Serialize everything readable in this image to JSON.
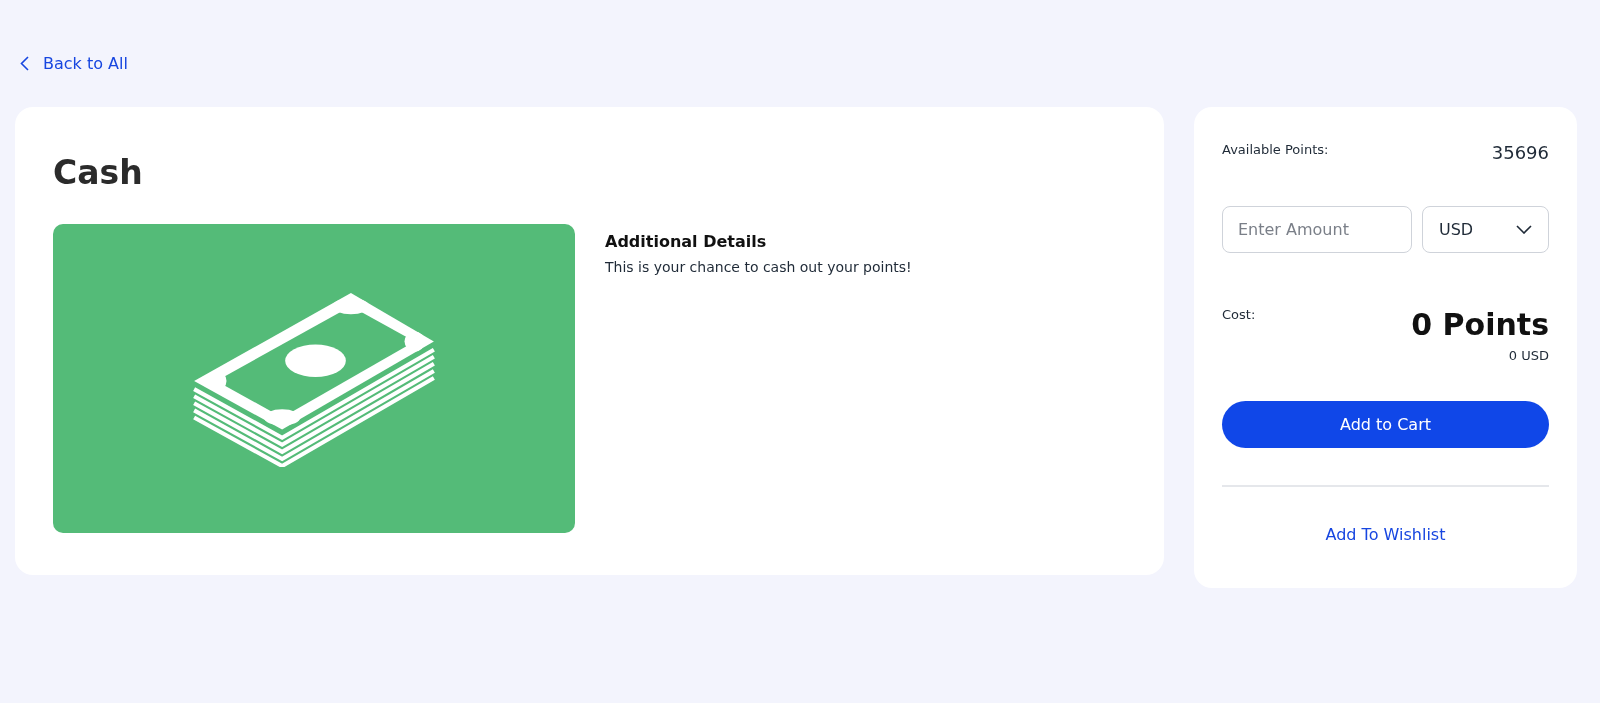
{
  "back_link": {
    "label": "Back to All"
  },
  "product": {
    "title": "Cash",
    "details_heading": "Additional Details",
    "details_text": "This is your chance to cash out your points!"
  },
  "purchase": {
    "available_label": "Available Points:",
    "available_value": "35696",
    "amount_field": {
      "placeholder": "Enter Amount"
    },
    "currency": "USD",
    "cost_label": "Cost:",
    "cost_points": "0 Points",
    "cost_currency": "0 USD",
    "add_to_cart": "Add to Cart",
    "add_to_wishlist": "Add To Wishlist"
  }
}
